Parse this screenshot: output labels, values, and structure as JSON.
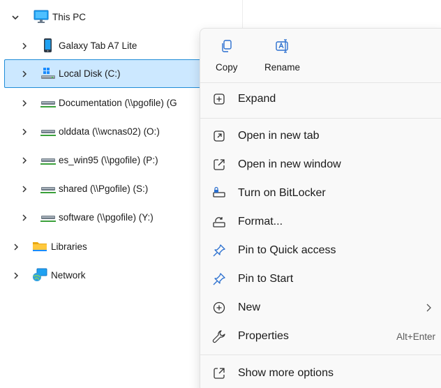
{
  "tree": {
    "this_pc": {
      "label": "This PC",
      "icon": "monitor-icon"
    },
    "items": [
      {
        "label": "Galaxy Tab A7 Lite",
        "icon": "tablet-icon"
      },
      {
        "label": "Local Disk (C:)",
        "icon": "windows-drive-icon",
        "selected": true
      },
      {
        "label": "Documentation (\\\\pgofile) (G",
        "icon": "network-drive-icon"
      },
      {
        "label": "olddata (\\\\wcnas02) (O:)",
        "icon": "network-drive-icon"
      },
      {
        "label": "es_win95 (\\\\pgofile) (P:)",
        "icon": "network-drive-icon"
      },
      {
        "label": "shared (\\\\Pgofile) (S:)",
        "icon": "network-drive-icon"
      },
      {
        "label": "software (\\\\pgofile) (Y:)",
        "icon": "network-drive-icon"
      }
    ],
    "libraries": {
      "label": "Libraries",
      "icon": "folder-icon"
    },
    "network": {
      "label": "Network",
      "icon": "network-icon"
    }
  },
  "menu": {
    "quick_actions": [
      {
        "label": "Copy",
        "icon": "copy-icon"
      },
      {
        "label": "Rename",
        "icon": "rename-icon"
      }
    ],
    "items": [
      {
        "label": "Expand",
        "icon": "plus-square-icon"
      },
      {
        "label": "Open in new tab",
        "icon": "new-tab-icon"
      },
      {
        "label": "Open in new window",
        "icon": "new-window-icon"
      },
      {
        "label": "Turn on BitLocker",
        "icon": "bitlocker-icon"
      },
      {
        "label": "Format...",
        "icon": "format-icon"
      },
      {
        "label": "Pin to Quick access",
        "icon": "pin-icon"
      },
      {
        "label": "Pin to Start",
        "icon": "pin-icon"
      },
      {
        "label": "New",
        "icon": "plus-circle-icon",
        "submenu": true
      },
      {
        "label": "Properties",
        "icon": "wrench-icon",
        "shortcut": "Alt+Enter"
      },
      {
        "label": "Show more options",
        "icon": "share-icon"
      }
    ]
  },
  "colors": {
    "selection_bg": "#cce8ff",
    "selection_border": "#1f8cd8",
    "icon_blue": "#2a6fcf",
    "menu_bg": "#f9f9f9"
  }
}
